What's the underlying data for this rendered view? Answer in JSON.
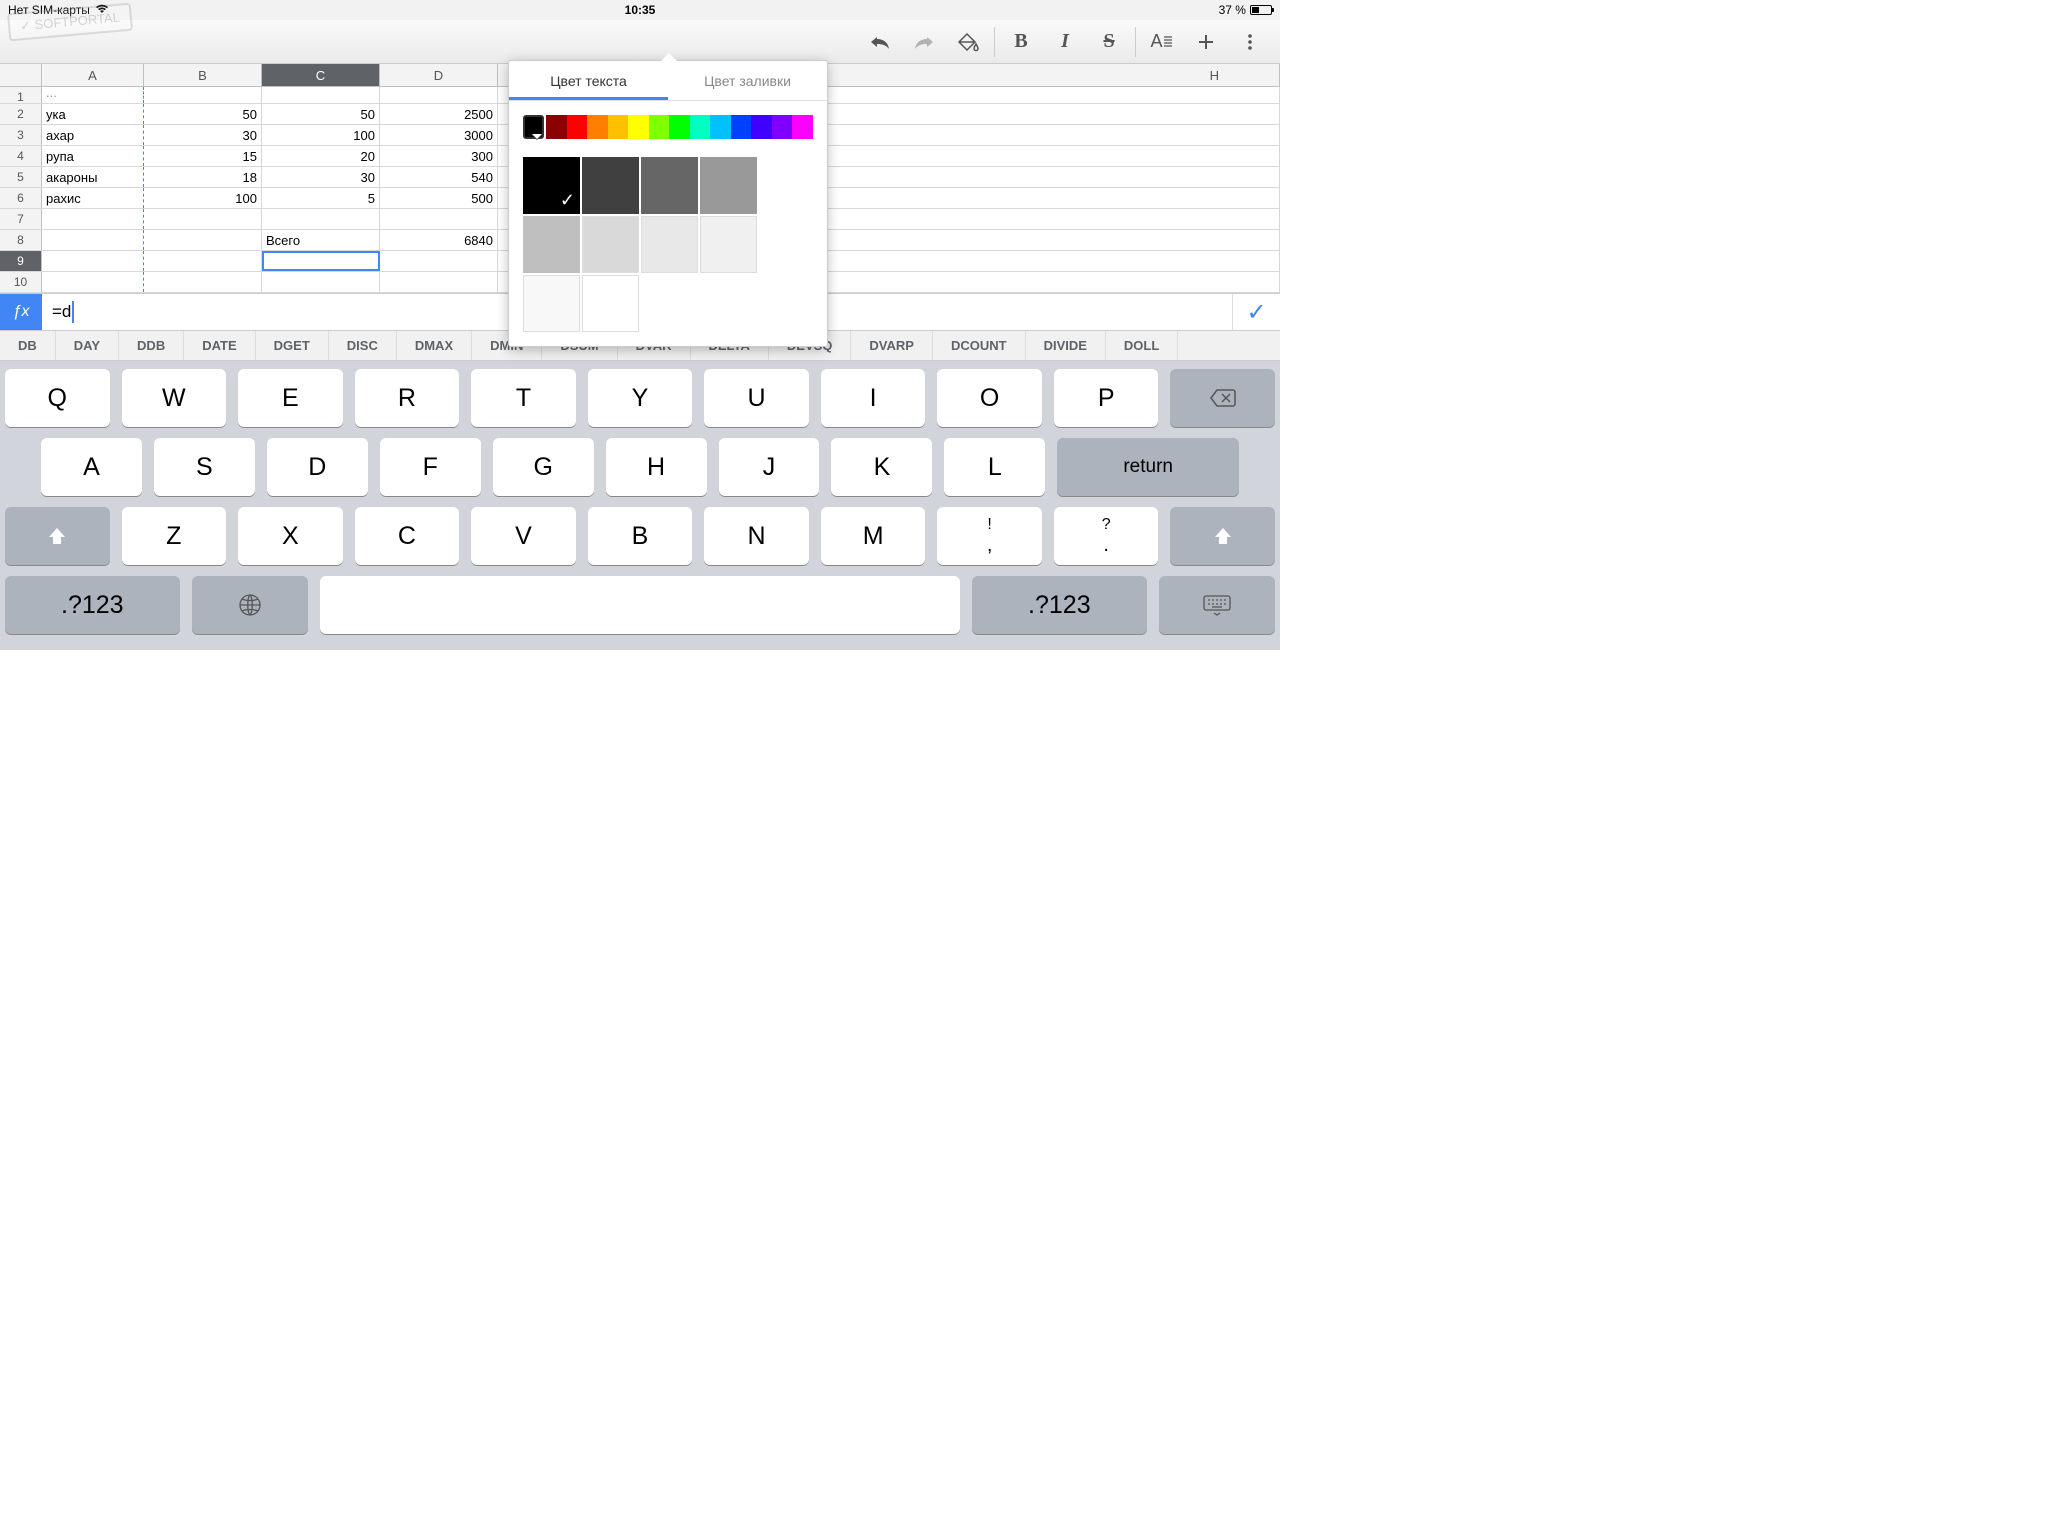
{
  "status": {
    "carrier": "Нет SIM-карты",
    "time": "10:35",
    "battery": "37 %"
  },
  "columns": [
    "A",
    "B",
    "C",
    "D",
    "H"
  ],
  "rows": [
    {
      "n": "1",
      "a": "...",
      "b": "",
      "c": "",
      "d": ""
    },
    {
      "n": "2",
      "a": "ука",
      "b": "50",
      "c": "50",
      "d": "2500"
    },
    {
      "n": "3",
      "a": "ахар",
      "b": "30",
      "c": "100",
      "d": "3000"
    },
    {
      "n": "4",
      "a": "рупа",
      "b": "15",
      "c": "20",
      "d": "300"
    },
    {
      "n": "5",
      "a": "акароны",
      "b": "18",
      "c": "30",
      "d": "540"
    },
    {
      "n": "6",
      "a": "рахис",
      "b": "100",
      "c": "5",
      "d": "500"
    },
    {
      "n": "7",
      "a": "",
      "b": "",
      "c": "",
      "d": ""
    },
    {
      "n": "8",
      "a": "",
      "b": "",
      "c": "Всего",
      "d": "6840"
    },
    {
      "n": "9",
      "a": "",
      "b": "",
      "c": "",
      "d": ""
    },
    {
      "n": "10",
      "a": "",
      "b": "",
      "c": "",
      "d": ""
    }
  ],
  "formula": {
    "value": "=d"
  },
  "suggestions": [
    "DB",
    "DAY",
    "DDB",
    "DATE",
    "DGET",
    "DISC",
    "DMAX",
    "DMIN",
    "DSUM",
    "DVAR",
    "DELTA",
    "DEVSQ",
    "DVARP",
    "DCOUNT",
    "DIVIDE",
    "DOLL"
  ],
  "panel": {
    "tab1": "Цвет текста",
    "tab2": "Цвет заливки"
  },
  "spectrum": [
    "#000000",
    "#8b0000",
    "#ff0000",
    "#ff8000",
    "#ffc000",
    "#ffff00",
    "#80ff00",
    "#00ff00",
    "#00ffc0",
    "#00c0ff",
    "#0040ff",
    "#4000ff",
    "#8000ff",
    "#ff00ff"
  ],
  "grays": [
    "#000000",
    "#404040",
    "#666666",
    "#999999",
    "#bfbfbf",
    "#d9d9d9",
    "#e8e8e8",
    "#f0f0f0",
    "#f8f8f8",
    "#ffffff"
  ],
  "keyboard": {
    "r1": [
      "Q",
      "W",
      "E",
      "R",
      "T",
      "Y",
      "U",
      "I",
      "O",
      "P"
    ],
    "r2": [
      "A",
      "S",
      "D",
      "F",
      "G",
      "H",
      "J",
      "K",
      "L"
    ],
    "r3": [
      "Z",
      "X",
      "C",
      "V",
      "B",
      "N",
      "M"
    ],
    "p1t": "!",
    "p1b": ",",
    "p2t": "?",
    "p2b": ".",
    "num": ".?123",
    "return": "return"
  },
  "watermark": "SOFTPORTAL"
}
